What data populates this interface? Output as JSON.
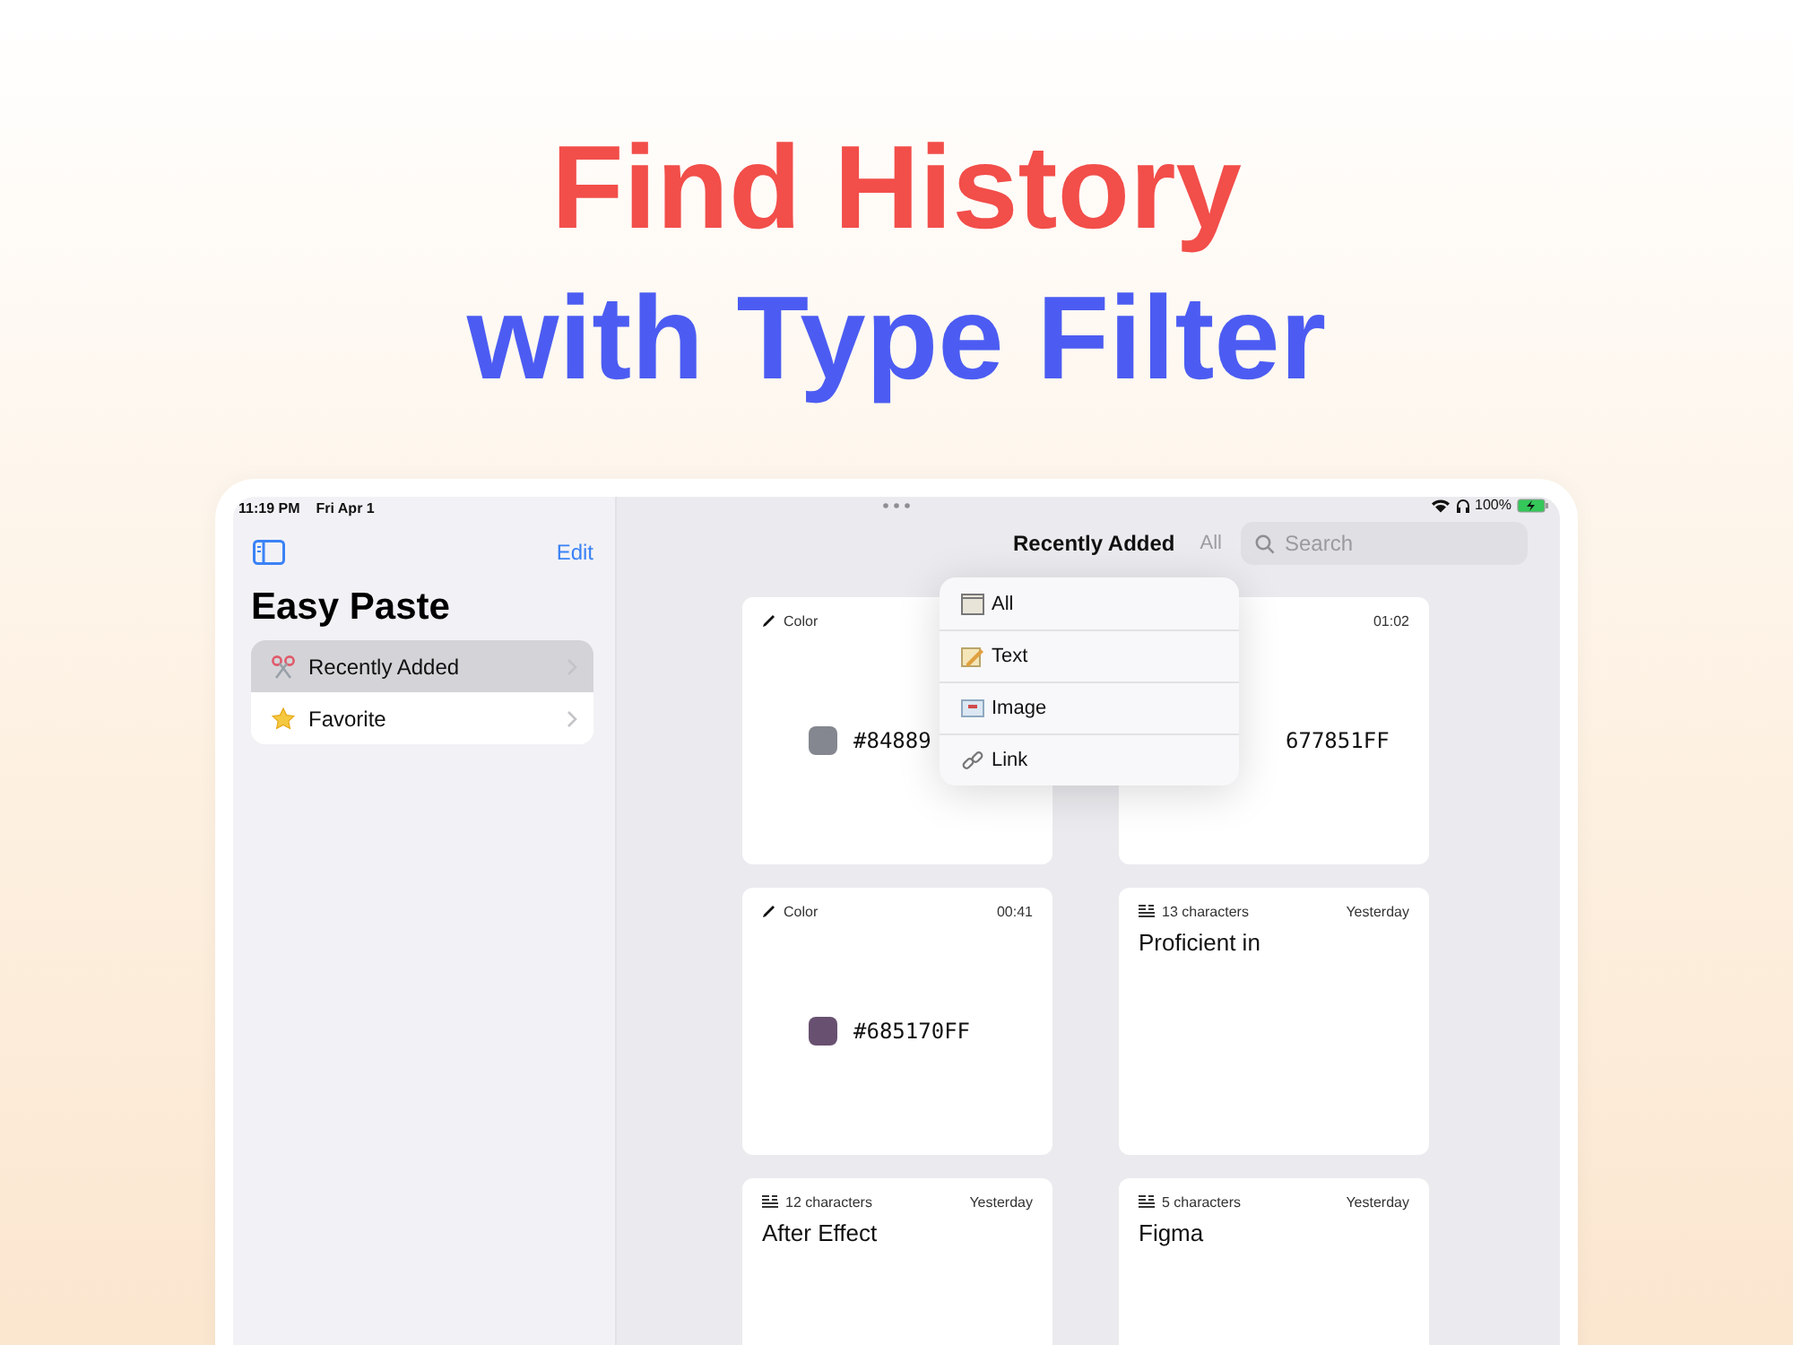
{
  "headline": {
    "line_1": "Find History",
    "line_2": "with Type Filter"
  },
  "status_bar": {
    "time": "11:19 PM",
    "date": "Fri Apr 1",
    "battery": "100%"
  },
  "sidebar": {
    "edit": "Edit",
    "title": "Easy Paste",
    "items": [
      {
        "label": "Recently Added",
        "selected": true,
        "kind": "recent"
      },
      {
        "label": "Favorite",
        "selected": false,
        "kind": "favorite"
      }
    ]
  },
  "toolbar": {
    "title": "Recently Added",
    "filter": "All",
    "search": {
      "placeholder": "Search"
    }
  },
  "filter_menu": {
    "items": [
      {
        "label": "All",
        "kind": "all"
      },
      {
        "label": "Text",
        "kind": "text"
      },
      {
        "label": "Image",
        "kind": "image"
      },
      {
        "label": "Link",
        "kind": "link"
      }
    ]
  },
  "cards": [
    {
      "kind": "color",
      "label": "Color",
      "value": "#84889",
      "color": "#84878f"
    },
    {
      "kind": "color",
      "time": "01:02",
      "value": "677851FF"
    },
    {
      "kind": "color",
      "label": "Color",
      "time": "00:41",
      "value": "#685170FF",
      "color": "#685170"
    },
    {
      "kind": "text",
      "label": "13 characters",
      "time": "Yesterday",
      "value": "Proficient in"
    },
    {
      "kind": "text",
      "label": "12 characters",
      "time": "Yesterday",
      "value": "After Effect"
    },
    {
      "kind": "text",
      "label": "5 characters",
      "time": "Yesterday",
      "value": "Figma"
    }
  ]
}
